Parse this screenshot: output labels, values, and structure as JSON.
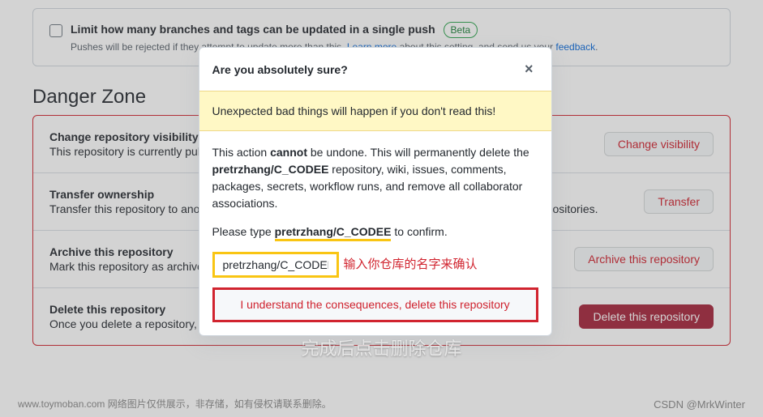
{
  "setting": {
    "title": "Limit how many branches and tags can be updated in a single push",
    "beta": "Beta",
    "desc_prefix": "Pushes will be rejected if they attempt to update more than this. ",
    "learn_more": "Learn more",
    "desc_mid": " about this setting, and send us your ",
    "feedback": "feedback",
    "desc_end": "."
  },
  "danger": {
    "heading": "Danger Zone",
    "rows": [
      {
        "title": "Change repository visibility",
        "desc": "This repository is currently public.",
        "button": "Change visibility"
      },
      {
        "title": "Transfer ownership",
        "desc": "Transfer this repository to another user or to an organization where you have the ability to create repositories.",
        "button": "Transfer"
      },
      {
        "title": "Archive this repository",
        "desc": "Mark this repository as archived and read-only.",
        "button": "Archive this repository"
      },
      {
        "title": "Delete this repository",
        "desc": "Once you delete a repository, there is no going back. Please be certain.",
        "button": "Delete this repository"
      }
    ]
  },
  "modal": {
    "title": "Are you absolutely sure?",
    "warning": "Unexpected bad things will happen if you don't read this!",
    "p1_a": "This action ",
    "p1_cannot": "cannot",
    "p1_b": " be undone. This will permanently delete the ",
    "repo_name": "pretrzhang/C_CODEE",
    "p1_c": " repository, wiki, issues, comments, packages, secrets, workflow runs, and remove all collaborator associations.",
    "p2_a": "Please type ",
    "p2_b": " to confirm.",
    "input_value": "pretrzhang/C_CODEE",
    "annotation": "输入你仓库的名字来确认",
    "confirm_button": "I understand the consequences, delete this repository"
  },
  "overlay_text": "完成后点击删除仓库",
  "footer": {
    "left": "www.toymoban.com  网络图片仅供展示，非存储，如有侵权请联系删除。",
    "right": "CSDN @MrkWinter"
  }
}
